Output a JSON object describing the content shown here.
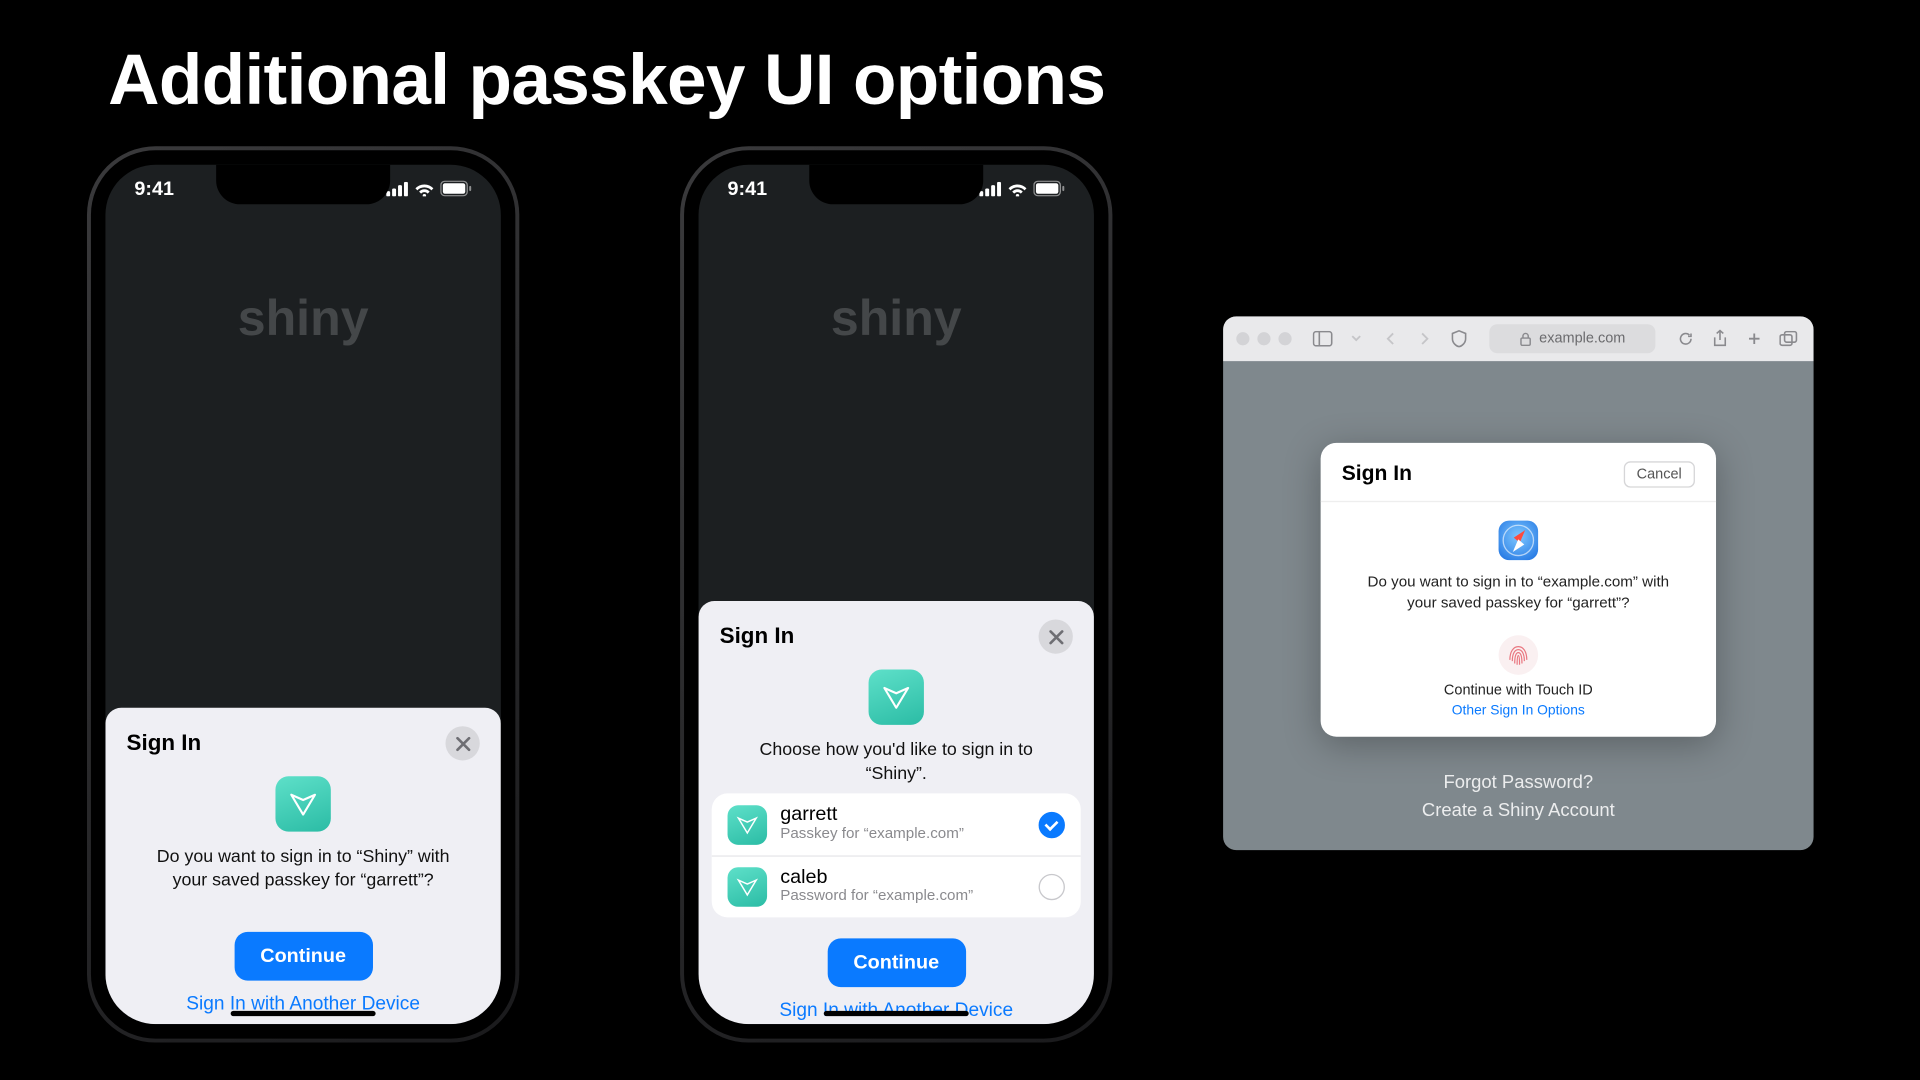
{
  "slide_title": "Additional passkey UI options",
  "status": {
    "time": "9:41"
  },
  "app_background_word": "shiny",
  "phone1": {
    "sheet_title": "Sign In",
    "prompt": "Do you want to sign in to “Shiny” with your saved passkey for “garrett”?",
    "continue": "Continue",
    "alt": "Sign In with Another Device"
  },
  "phone2": {
    "sheet_title": "Sign In",
    "prompt": "Choose how you'd like to sign in to “Shiny”.",
    "continue": "Continue",
    "alt": "Sign In with Another Device",
    "credentials": [
      {
        "name": "garrett",
        "sub": "Passkey for “example.com”",
        "selected": true
      },
      {
        "name": "caleb",
        "sub": "Password for “example.com”",
        "selected": false
      }
    ]
  },
  "mac": {
    "url": "example.com",
    "dialog_title": "Sign In",
    "cancel": "Cancel",
    "prompt": "Do you want to sign in to “example.com” with your saved passkey for “garrett”?",
    "touchid": "Continue with Touch ID",
    "other": "Other Sign In Options",
    "forgot": "Forgot Password?",
    "create": "Create a Shiny Account"
  }
}
